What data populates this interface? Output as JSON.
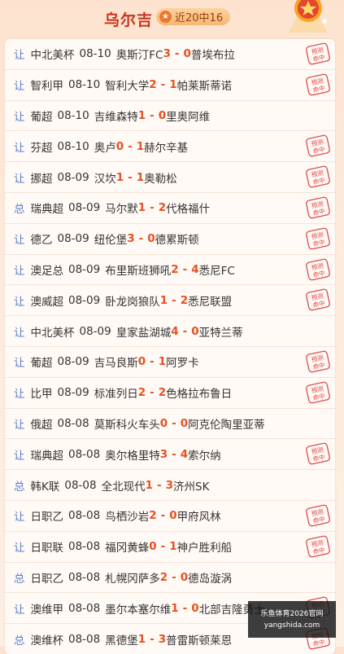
{
  "header": {
    "title": "乌尔吉",
    "badge_text": "近20中16",
    "badge_icon": "star-icon"
  },
  "stamp_text": "预测命中",
  "matches": [
    {
      "type": "让",
      "league": "中北美杯",
      "date": "08-10",
      "home": "奥斯汀FC",
      "hs": "3",
      "as": "0",
      "away": "普埃布拉",
      "hit": true
    },
    {
      "type": "让",
      "league": "智利甲",
      "date": "08-10",
      "home": "智利大学",
      "hs": "2",
      "as": "1",
      "away": "帕莱斯蒂诺",
      "hit": true
    },
    {
      "type": "让",
      "league": "葡超",
      "date": "08-10",
      "home": "吉维森特",
      "hs": "1",
      "as": "0",
      "away": "里奥阿维",
      "hit": false
    },
    {
      "type": "让",
      "league": "芬超",
      "date": "08-10",
      "home": "奥卢",
      "hs": "0",
      "as": "1",
      "away": "赫尔辛基",
      "hit": true
    },
    {
      "type": "让",
      "league": "挪超",
      "date": "08-09",
      "home": "汉坎",
      "hs": "1",
      "as": "1",
      "away": "奥勒松",
      "hit": true
    },
    {
      "type": "总",
      "league": "瑞典超",
      "date": "08-09",
      "home": "马尔默",
      "hs": "1",
      "as": "2",
      "away": "代格福什",
      "hit": true
    },
    {
      "type": "让",
      "league": "德乙",
      "date": "08-09",
      "home": "纽伦堡",
      "hs": "3",
      "as": "0",
      "away": "德累斯顿",
      "hit": true
    },
    {
      "type": "让",
      "league": "澳足总",
      "date": "08-09",
      "home": "布里斯班狮吼",
      "hs": "2",
      "as": "4",
      "away": "悉尼FC",
      "hit": true
    },
    {
      "type": "让",
      "league": "澳威超",
      "date": "08-09",
      "home": "卧龙岗狼队",
      "hs": "1",
      "as": "2",
      "away": "悉尼联盟",
      "hit": true
    },
    {
      "type": "让",
      "league": "中北美杯",
      "date": "08-09",
      "home": "皇家盐湖城",
      "hs": "4",
      "as": "0",
      "away": "亚特兰蒂",
      "hit": false
    },
    {
      "type": "让",
      "league": "葡超",
      "date": "08-09",
      "home": "吉马良斯",
      "hs": "0",
      "as": "1",
      "away": "阿罗卡",
      "hit": true
    },
    {
      "type": "让",
      "league": "比甲",
      "date": "08-09",
      "home": "标准列日",
      "hs": "2",
      "as": "2",
      "away": "色格拉布鲁日",
      "hit": true
    },
    {
      "type": "让",
      "league": "俄超",
      "date": "08-08",
      "home": "莫斯科火车头",
      "hs": "0",
      "as": "0",
      "away": "阿克伦陶里亚蒂",
      "hit": false
    },
    {
      "type": "让",
      "league": "瑞典超",
      "date": "08-08",
      "home": "奥尔格里特",
      "hs": "3",
      "as": "4",
      "away": "索尔纳",
      "hit": true
    },
    {
      "type": "总",
      "league": "韩K联",
      "date": "08-08",
      "home": "全北现代",
      "hs": "1",
      "as": "3",
      "away": "济州SK",
      "hit": false
    },
    {
      "type": "让",
      "league": "日职乙",
      "date": "08-08",
      "home": "鸟栖沙岩",
      "hs": "2",
      "as": "0",
      "away": "甲府风林",
      "hit": true
    },
    {
      "type": "让",
      "league": "日职联",
      "date": "08-08",
      "home": "福冈黄蜂",
      "hs": "0",
      "as": "1",
      "away": "神户胜利船",
      "hit": true
    },
    {
      "type": "总",
      "league": "日职乙",
      "date": "08-08",
      "home": "札幌冈萨多",
      "hs": "2",
      "as": "0",
      "away": "德岛漩涡",
      "hit": false
    },
    {
      "type": "让",
      "league": "澳维甲",
      "date": "08-08",
      "home": "墨尔本塞尔维",
      "hs": "1",
      "as": "0",
      "away": "北部吉隆勇士",
      "hit": true
    },
    {
      "type": "总",
      "league": "澳维杯",
      "date": "08-08",
      "home": "黑德堡",
      "hs": "1",
      "as": "3",
      "away": "普雷斯顿莱恩",
      "hit": true
    }
  ],
  "watermark": {
    "line1": "乐鱼体育2026官网",
    "line2": "yangshida.com"
  },
  "colors": {
    "accent": "#e8501f",
    "type": "#5a7fd0",
    "stamp": "#e04a4a"
  }
}
